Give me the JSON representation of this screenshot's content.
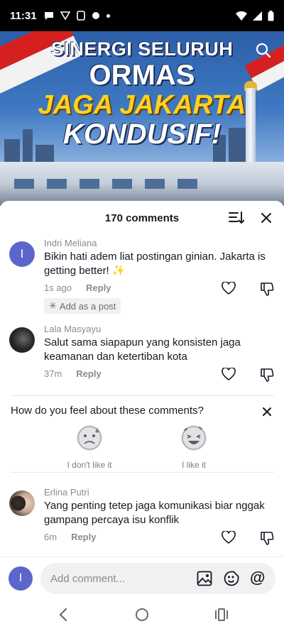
{
  "status_bar": {
    "time": "11:31"
  },
  "banner": {
    "line1": "SINERGI SELURUH",
    "line2": "ORMAS",
    "line3": "JAGA JAKARTA",
    "line4": "KONDUSIF!"
  },
  "header": {
    "title": "170 comments"
  },
  "comments": [
    {
      "avatar_letter": "I",
      "name": "Indri Meliana",
      "text": "Bikin hati adem liat postingan ginian. Jakarta is getting better! ✨",
      "time": "1s ago",
      "reply": "Reply",
      "add_post": "Add as a post"
    },
    {
      "name": "Lala Masyayu",
      "text": "Salut sama siapapun yang konsisten jaga keamanan dan ketertiban kota",
      "time": "37m",
      "reply": "Reply"
    },
    {
      "name": "Erlina Putri",
      "text": "Yang penting tetep jaga komunikasi biar nggak gampang percaya isu konflik",
      "time": "6m",
      "reply": "Reply"
    }
  ],
  "survey": {
    "question": "How do you feel about these comments?",
    "options": [
      {
        "label": "I don't like it"
      },
      {
        "label": "I like it"
      }
    ]
  },
  "input": {
    "avatar_letter": "I",
    "placeholder": "Add comment...",
    "at_symbol": "@"
  }
}
